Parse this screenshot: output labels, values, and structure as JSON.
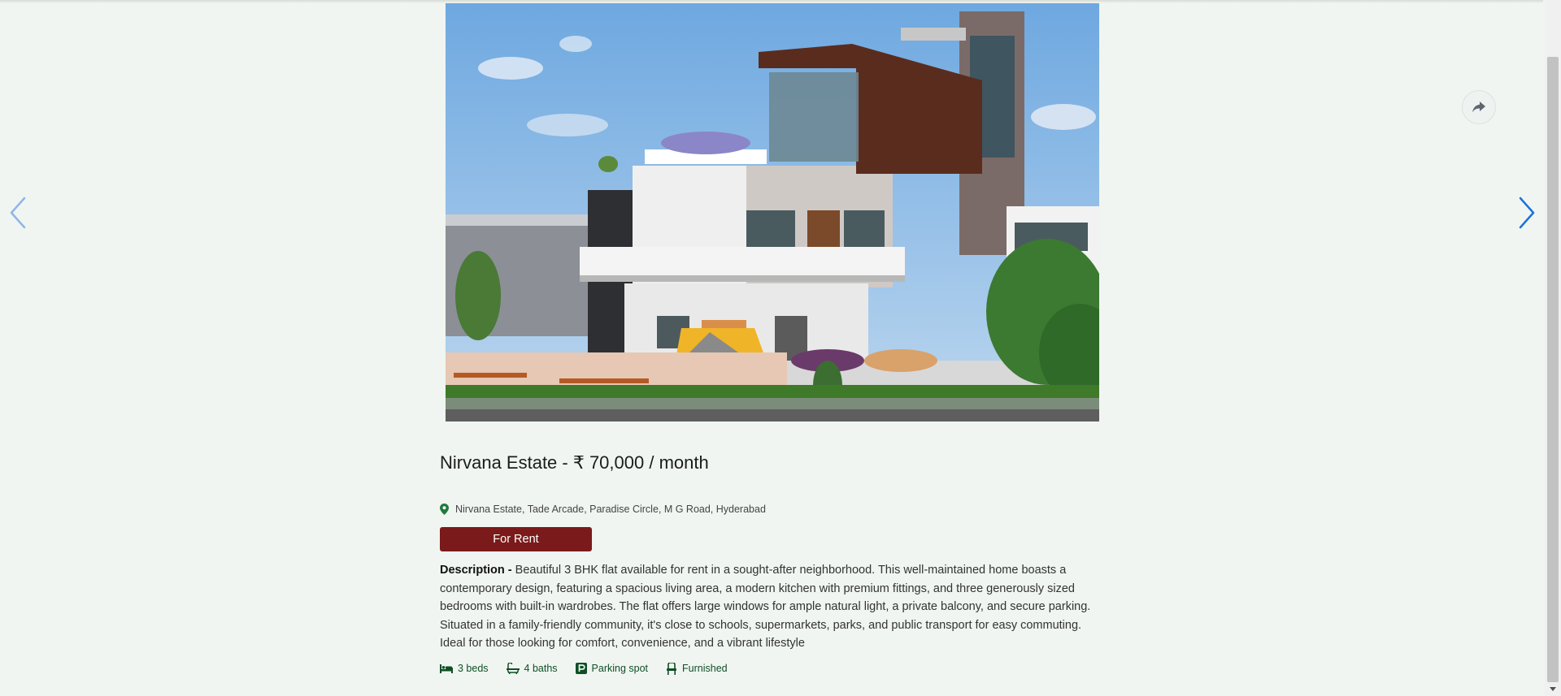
{
  "listing": {
    "title": "Nirvana Estate - ₹ 70,000 / month",
    "address": "Nirvana Estate, Tade Arcade, Paradise Circle, M G Road, Hyderabad",
    "status_badge": "For Rent",
    "description_label": "Description -",
    "description_text": "Beautiful 3 BHK flat available for rent in a sought-after neighborhood. This well-maintained home boasts a contemporary design, featuring a spacious living area, a modern kitchen with premium fittings, and three generously sized bedrooms with built-in wardrobes. The flat offers large windows for ample natural light, a private balcony, and secure parking. Situated in a family-friendly community, it's close to schools, supermarkets, parks, and public transport for easy commuting. Ideal for those looking for comfort, convenience, and a vibrant lifestyle",
    "features": {
      "beds": "3 beds",
      "baths": "4 baths",
      "parking": "Parking spot",
      "furnished": "Furnished"
    }
  },
  "gallery": {
    "prev_icon": "chevron-left-icon",
    "next_icon": "chevron-right-icon",
    "share_icon": "share-icon"
  },
  "colors": {
    "background": "#f0f5f1",
    "badge": "#7b1a1a",
    "feature_text": "#0e4f26",
    "location_pin": "#1f7a3a",
    "arrow_prev": "#8fb6e8",
    "arrow_next": "#1a73d9"
  }
}
